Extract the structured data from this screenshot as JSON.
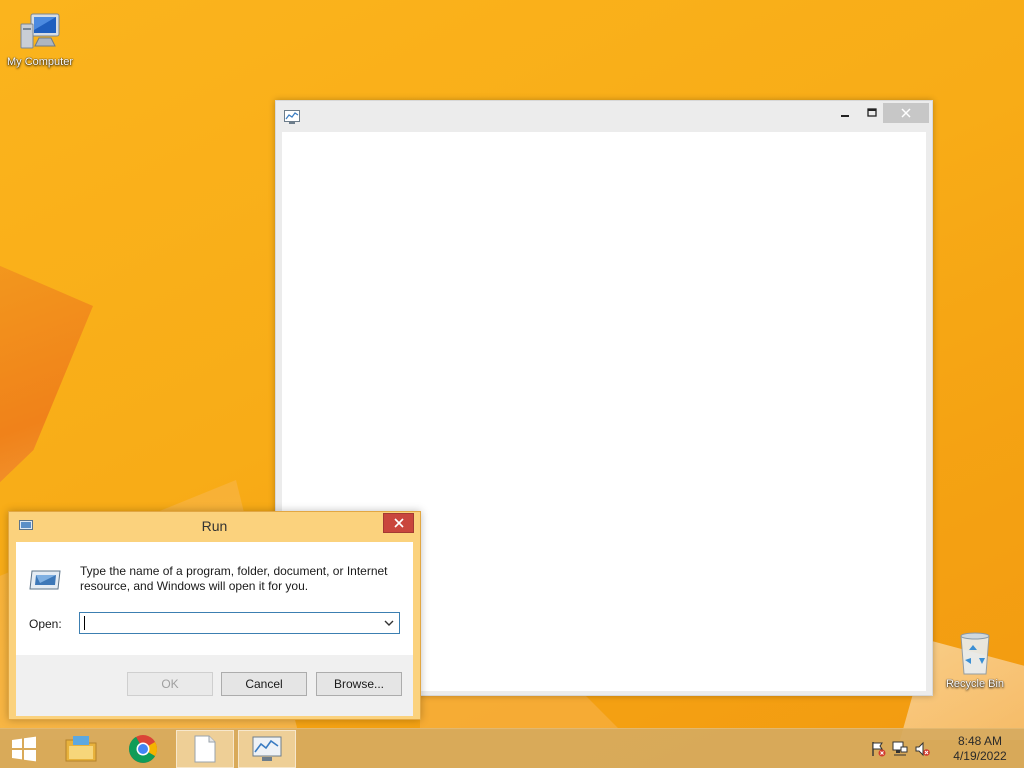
{
  "desktop": {
    "icons": [
      {
        "label": "My Computer",
        "icon": "computer-icon"
      },
      {
        "label": "Recycle Bin",
        "icon": "recycle-bin-icon"
      }
    ]
  },
  "blank_window": {
    "title": "",
    "controls": {
      "minimize": "—",
      "maximize": "☐",
      "close": "✕"
    }
  },
  "run_dialog": {
    "title": "Run",
    "close_glyph": "✕",
    "description": "Type the name of a program, folder, document, or Internet resource, and Windows will open it for you.",
    "open_label": "Open:",
    "open_value": "",
    "buttons": {
      "ok": "OK",
      "cancel": "Cancel",
      "browse": "Browse..."
    }
  },
  "taskbar": {
    "items": [
      "start-icon",
      "file-explorer-icon",
      "chrome-icon",
      "notepad-icon",
      "app-icon"
    ],
    "clock": {
      "time": "8:48 AM",
      "date": "4/19/2022"
    }
  },
  "colors": {
    "desktop": "#f6a815",
    "dialog_frame": "#fbd27d",
    "close_red": "#c9463d",
    "combo_border": "#3c7fb1"
  }
}
